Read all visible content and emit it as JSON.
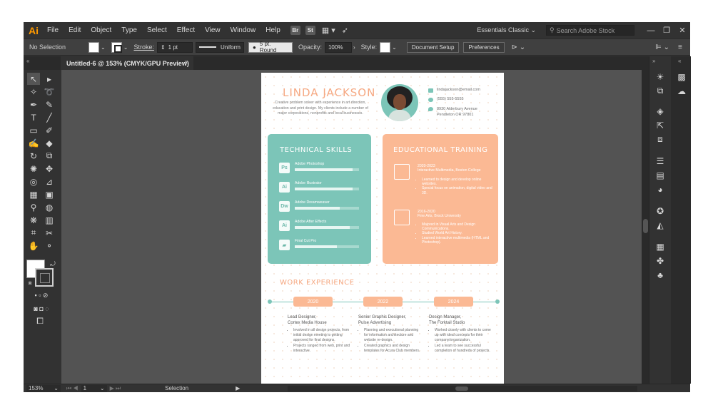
{
  "menubar": {
    "logo": "Ai",
    "items": [
      "File",
      "Edit",
      "Object",
      "Type",
      "Select",
      "Effect",
      "View",
      "Window",
      "Help"
    ],
    "badge_br": "Br",
    "badge_st": "St",
    "workspace": "Essentials Classic",
    "stock_placeholder": "Search Adobe Stock",
    "win_min": "—",
    "win_max": "❐",
    "win_close": "✕"
  },
  "controlbar": {
    "selection_state": "No Selection",
    "stroke_label": "Stroke:",
    "stroke_weight": "1 pt",
    "profile": "Uniform",
    "brush": "5 pt. Round",
    "opacity_label": "Opacity:",
    "opacity_value": "100%",
    "style_label": "Style:",
    "document_setup": "Document Setup",
    "preferences": "Preferences"
  },
  "document_tab": {
    "title": "Untitled-6 @ 153% (CMYK/GPU Preview)",
    "close": "×"
  },
  "statusbar": {
    "zoom": "153%",
    "artboard": "1",
    "tool": "Selection"
  },
  "resume": {
    "name": "LINDA JACKSON",
    "bio": "Creative problem solver with experience in art direction, education and print design. My clients include a number of major corporations, nonprofits and local businesses.",
    "email": "lindajackson@email.com",
    "phone": "(555) 555-5555",
    "address_line1": "8930 Alderbury Avenue",
    "address_line2": "Pendleton OR 97801",
    "skills_title": "TECHNICAL SKILLS",
    "skills": [
      {
        "abbr": "Ps",
        "name": "Adobe Photoshop",
        "level": 0.9
      },
      {
        "abbr": "Ai",
        "name": "Adobe Illustrator",
        "level": 0.9
      },
      {
        "abbr": "Dw",
        "name": "Adobe Dreamweaver",
        "level": 0.7
      },
      {
        "abbr": "Ai",
        "name": "Adobe After Effects",
        "level": 0.85
      },
      {
        "abbr": "",
        "name": "Final Cut Pro",
        "level": 0.65
      }
    ],
    "education_title": "EDUCATIONAL TRAINING",
    "education": [
      {
        "years": "2020-2023",
        "school": "Interactive Multimedia, Boston College",
        "points": [
          "Learned to design and develop online websites.",
          "Special focus on animation, digital video and 3D."
        ]
      },
      {
        "years": "2016-2020",
        "school": "Fine Arts, Brock University",
        "points": [
          "Majored in Visual Arts and Design Communications.",
          "Studied World Art History.",
          "Learned interactive multimedia (HTML and Photoshop)."
        ]
      }
    ],
    "work_title": "WORK EXPERIENCE",
    "jobs": [
      {
        "year": "2020",
        "title": "Lead Designer,",
        "company": "Cortex Media House",
        "points": [
          "Involved in all design projects, from initial design meeting to getting approved for final designs.",
          "Projects ranged from web, print and interactive."
        ]
      },
      {
        "year": "2022",
        "title": "Senior Graphic Designer,",
        "company": "Pulse Advertising",
        "points": [
          "Planning and executional planning for information architecture and website re-design.",
          "Created graphics and design templates for Acura Club members."
        ]
      },
      {
        "year": "2024",
        "title": "Design Manager,",
        "company": "The Forktail Studio",
        "points": [
          "Worked closely with clients to come up with ideal concepts for their company/organization.",
          "Led a team to see successful completion of hundreds of projects."
        ]
      }
    ]
  },
  "colors": {
    "teal": "#7cc5b8",
    "peach": "#fbb994",
    "accent_text": "#f6a983",
    "ui_dark": "#323232"
  }
}
